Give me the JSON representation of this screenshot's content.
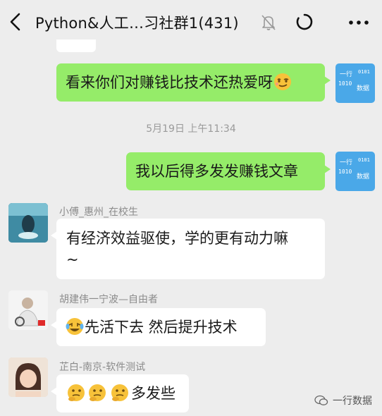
{
  "header": {
    "title": "Python&人工…习社群1(431)",
    "icons": [
      "back-icon",
      "mute-icon",
      "loading-icon",
      "more-icon"
    ]
  },
  "self_avatar": {
    "line1": "一行",
    "bits": "1010",
    "bits_top": "0101",
    "word": "数据"
  },
  "messages": [
    {
      "side": "right",
      "text": "看来你们对赚钱比技术还热爱呀"
    },
    {
      "side": "right",
      "text": "我以后得多发发赚钱文章"
    },
    {
      "sender": "小傅_惠州_在校生",
      "side": "left",
      "text_line1": "有经济效益驱使，学的更有动力嘛",
      "text_line2": "~"
    },
    {
      "sender": "胡建伟一宁波—自由者",
      "side": "left",
      "text": "先活下去 然后提升技术"
    },
    {
      "sender": "芷白-南京-软件测试",
      "side": "left",
      "text": "多发些"
    }
  ],
  "timestamp": "5月19日 上午11:34",
  "watermark": "一行数据",
  "colors": {
    "background": "#ededed",
    "self_bubble": "#95ec69",
    "other_bubble": "#ffffff",
    "avatar_blue": "#4aa8e8"
  }
}
